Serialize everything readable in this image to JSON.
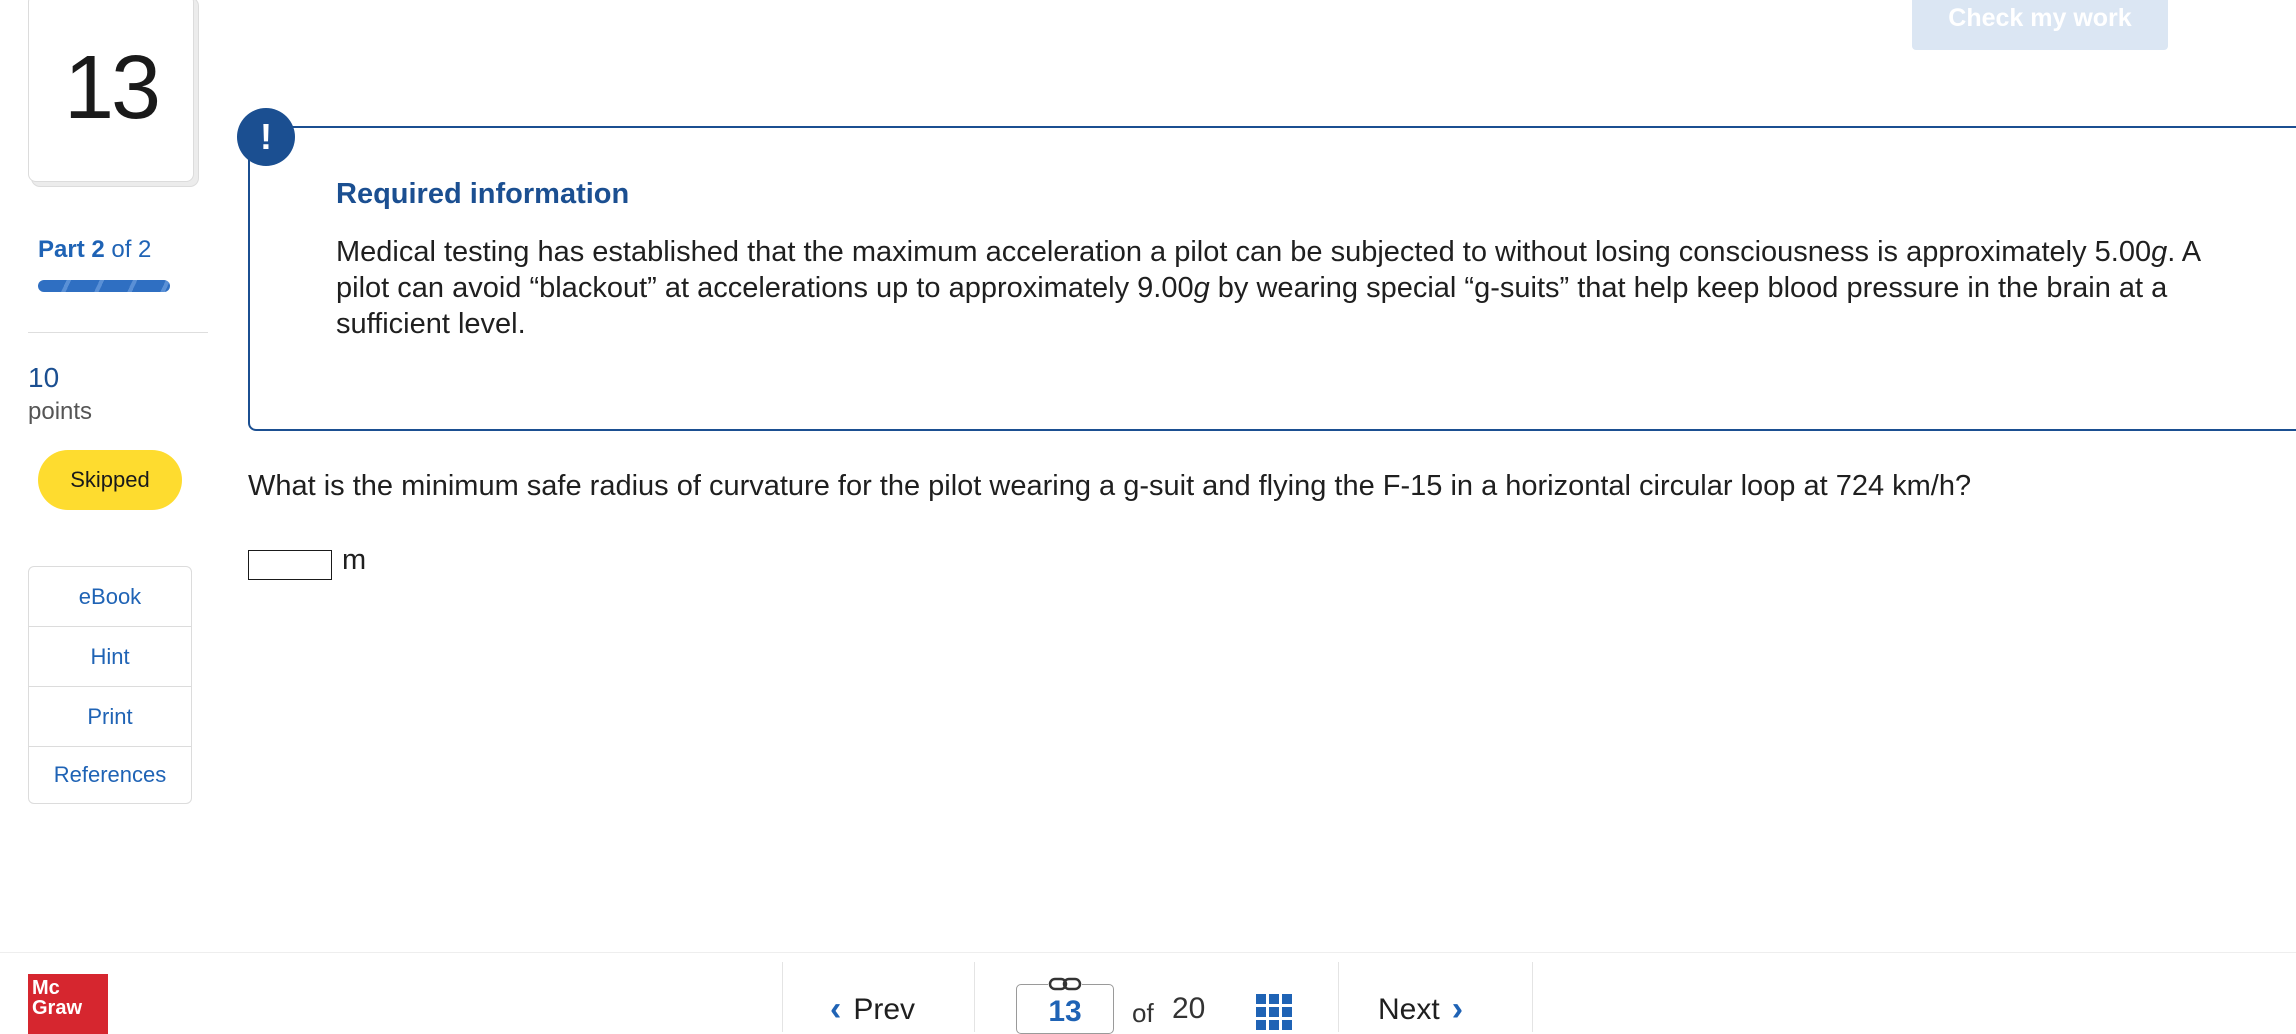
{
  "question": {
    "number": "13",
    "part_bold": "Part 2",
    "part_rest": " of 2",
    "points_value": "10",
    "points_label": "points",
    "status": "Skipped",
    "progress_fraction": 1.0
  },
  "tools": [
    {
      "label": "eBook"
    },
    {
      "label": "Hint"
    },
    {
      "label": "Print"
    },
    {
      "label": "References"
    }
  ],
  "header": {
    "check_label": "Check my work"
  },
  "info": {
    "icon": "!",
    "title": "Required information",
    "text_1": "Medical testing has established that the maximum acceleration a pilot can be subjected to without losing consciousness is approximately 5.00",
    "g_1": "g",
    "text_2": ". A pilot can avoid “blackout” at accelerations up to approximately 9.00",
    "g_2": "g",
    "text_3": " by wearing special “g-suits” that help keep blood pressure in the brain at a sufficient level."
  },
  "prompt": {
    "text": "What is the minimum safe radius of curvature for the pilot wearing a g-suit and flying the F-15 in a horizontal circular loop at 724 km/h?",
    "answer_value": "",
    "unit": "m"
  },
  "footer": {
    "logo_line1": "Mc",
    "logo_line2": "Graw",
    "prev_label": "Prev",
    "current_page": "13",
    "of_label": "of",
    "total_pages": "20",
    "next_label": "Next"
  },
  "colors": {
    "accent": "#1f63b5",
    "navy": "#1b4f91",
    "badge": "#fedc2f",
    "brand_red": "#d6262f"
  }
}
